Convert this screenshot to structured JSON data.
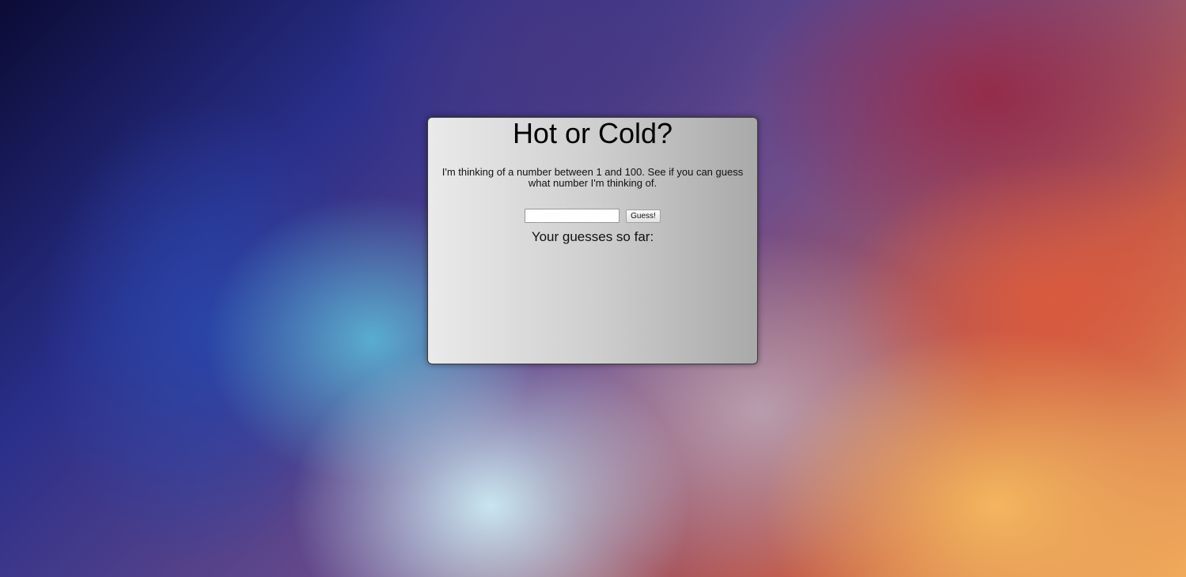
{
  "game": {
    "title": "Hot or Cold?",
    "intro": "I'm thinking of a number between 1 and 100. See if you can guess what number I'm thinking of.",
    "input_value": "",
    "input_placeholder": "",
    "guess_button_label": "Guess!",
    "guesses_heading": "Your guesses so far:",
    "guesses": []
  }
}
